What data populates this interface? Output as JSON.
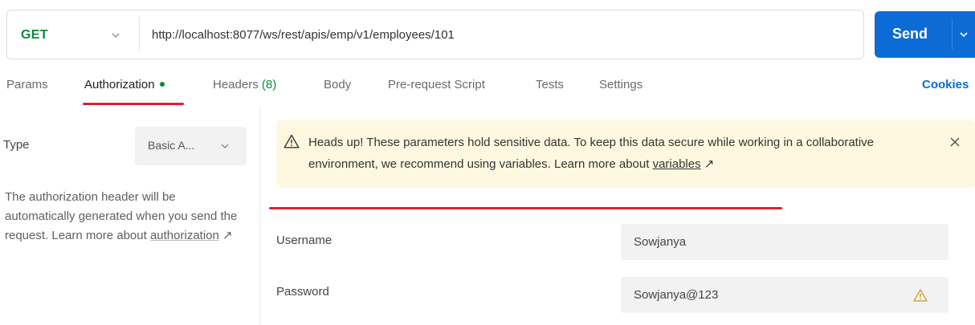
{
  "request": {
    "method": "GET",
    "url": "http://localhost:8077/ws/rest/apis/emp/v1/employees/101",
    "send_label": "Send"
  },
  "tabs": [
    {
      "label": "Params"
    },
    {
      "label": "Authorization"
    },
    {
      "label": "Headers",
      "count": "(8)"
    },
    {
      "label": "Body"
    },
    {
      "label": "Pre-request Script"
    },
    {
      "label": "Tests"
    },
    {
      "label": "Settings"
    }
  ],
  "cookies_label": "Cookies",
  "auth": {
    "type_label": "Type",
    "type_value": "Basic A...",
    "description": "The authorization header will be automatically generated when you send the request. Learn more about",
    "description_link": "authorization",
    "link_arrow": "↗"
  },
  "banner": {
    "text": "Heads up! These parameters hold sensitive data. To keep this data secure while working in a collaborative environment, we recommend using variables. Learn more about",
    "link": "variables",
    "link_arrow": "↗"
  },
  "fields": {
    "username_label": "Username",
    "username_value": "Sowjanya",
    "password_label": "Password",
    "password_value": "Sowjanya@123"
  },
  "colors": {
    "send_button": "#0d6bd6",
    "method_get": "#0b8a3e",
    "annotation_underline": "#e0202a",
    "banner_bg": "#fff8e1"
  }
}
